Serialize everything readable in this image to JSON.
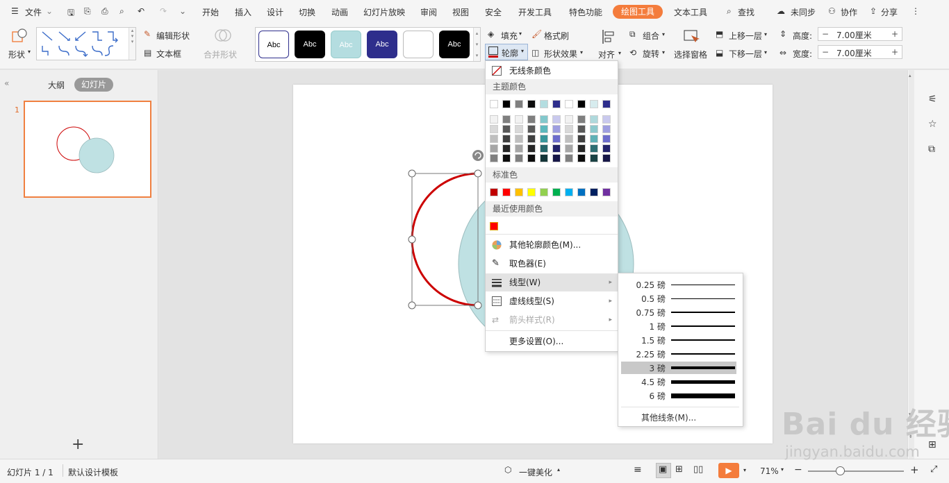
{
  "menubar": {
    "file": "文件",
    "tabs": [
      "开始",
      "插入",
      "设计",
      "切换",
      "动画",
      "幻灯片放映",
      "审阅",
      "视图",
      "安全",
      "开发工具",
      "特色功能"
    ],
    "active_tab": "绘图工具",
    "text_tool_tab": "文本工具",
    "search": "查找",
    "sync": "未同步",
    "collab": "协作",
    "share": "分享"
  },
  "ribbon": {
    "shape": "形状",
    "edit_shape": "编辑形状",
    "textbox": "文本框",
    "merge_shape": "合并形状",
    "styles": [
      "Abc",
      "Abc",
      "Abc",
      "Abc",
      "",
      "Abc"
    ],
    "fill": "填充",
    "format_painter": "格式刷",
    "outline": "轮廓",
    "shape_effect": "形状效果",
    "align": "对齐",
    "group": "组合",
    "rotate": "旋转",
    "selection_pane": "选择窗格",
    "bring_forward": "上移一层",
    "send_backward": "下移一层",
    "height_label": "高度:",
    "height_value": "7.00厘米",
    "width_label": "宽度:",
    "width_value": "7.00厘米"
  },
  "left_panel": {
    "outline_tab": "大纲",
    "slides_tab": "幻灯片",
    "slide_number": "1",
    "add": "+"
  },
  "outline_menu": {
    "no_line": "无线条颜色",
    "theme_colors": "主题颜色",
    "standard_colors": "标准色",
    "recent_colors": "最近使用颜色",
    "more_colors": "其他轮廓颜色(M)...",
    "eyedropper": "取色器(E)",
    "line_type": "线型(W)",
    "dash_type": "虚线线型(S)",
    "arrow_style": "箭头样式(R)",
    "more_settings": "更多设置(O)...",
    "theme_row": [
      "#ffffff",
      "#000000",
      "#7f7f7f",
      "#0d0d0d",
      "#b4dde0",
      "#2e2e8c",
      "#ffffff",
      "#000000",
      "#d7ecee",
      "#2e2e8c"
    ],
    "theme_shades": [
      [
        "#f2f2f2",
        "#7f7f7f",
        "#f2f2f2",
        "#7f7f7f",
        "#83c8cc",
        "#c9c9ee",
        "#f2f2f2",
        "#7f7f7f",
        "#afd9dc",
        "#c9c9ee"
      ],
      [
        "#d9d9d9",
        "#595959",
        "#d9d9d9",
        "#595959",
        "#5db8bd",
        "#9e9ee0",
        "#d9d9d9",
        "#595959",
        "#8cc8cc",
        "#9e9ee0"
      ],
      [
        "#bfbfbf",
        "#404040",
        "#bfbfbf",
        "#404040",
        "#3a979c",
        "#6d6dcc",
        "#bfbfbf",
        "#404040",
        "#5fb0b5",
        "#6d6dcc"
      ],
      [
        "#a6a6a6",
        "#262626",
        "#a6a6a6",
        "#262626",
        "#26666a",
        "#23236a",
        "#a6a6a6",
        "#262626",
        "#2e6e72",
        "#23236a"
      ],
      [
        "#808080",
        "#0d0d0d",
        "#808080",
        "#0d0d0d",
        "#143538",
        "#171747",
        "#808080",
        "#0d0d0d",
        "#1a4244",
        "#171747"
      ]
    ],
    "standard_row": [
      "#c00000",
      "#ff0000",
      "#ffc000",
      "#ffff00",
      "#92d050",
      "#00b050",
      "#00b0f0",
      "#0070c0",
      "#002060",
      "#7030a0"
    ],
    "recent_row": [
      "#ff0000"
    ]
  },
  "line_submenu": {
    "items": [
      "0.25 磅",
      "0.5 磅",
      "0.75 磅",
      "1 磅",
      "1.5 磅",
      "2.25 磅",
      "3 磅",
      "4.5 磅",
      "6 磅"
    ],
    "selected": "3 磅",
    "more_lines": "其他线条(M)..."
  },
  "statusbar": {
    "slide_info": "幻灯片 1 / 1",
    "template": "默认设计模板",
    "beautify": "一键美化",
    "zoom": "71%"
  },
  "watermark": {
    "brand": "Bai du 经验",
    "url": "jingyan.baidu.com"
  },
  "colors": {
    "accent": "#f47c3c",
    "shape_stroke": "#cc0000",
    "circle_fill": "#bfe1e3"
  }
}
